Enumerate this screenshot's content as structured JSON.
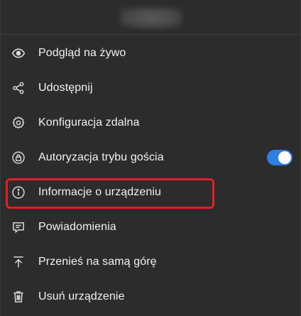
{
  "header": {
    "device_name": ""
  },
  "menu": {
    "items": [
      {
        "id": "live-preview",
        "label": "Podgląd na żywo",
        "icon": "eye-icon"
      },
      {
        "id": "share",
        "label": "Udostępnij",
        "icon": "share-icon"
      },
      {
        "id": "remote-config",
        "label": "Konfiguracja zdalna",
        "icon": "gear-icon"
      },
      {
        "id": "guest-auth",
        "label": "Autoryzacja trybu gościa",
        "icon": "lock-icon",
        "toggle_on": true
      },
      {
        "id": "device-info",
        "label": "Informacje o urządzeniu",
        "icon": "info-icon",
        "highlighted": true
      },
      {
        "id": "notifications",
        "label": "Powiadomienia",
        "icon": "message-icon"
      },
      {
        "id": "move-top",
        "label": "Przenieś na samą górę",
        "icon": "move-to-top-icon"
      },
      {
        "id": "delete-device",
        "label": "Usuń urządzenie",
        "icon": "trash-icon"
      }
    ]
  },
  "colors": {
    "background": "#2c2c2c",
    "text": "#f2f2f2",
    "icon": "#d9d9d9",
    "toggle_on": "#2f7fe6",
    "highlight": "#e81d24"
  }
}
